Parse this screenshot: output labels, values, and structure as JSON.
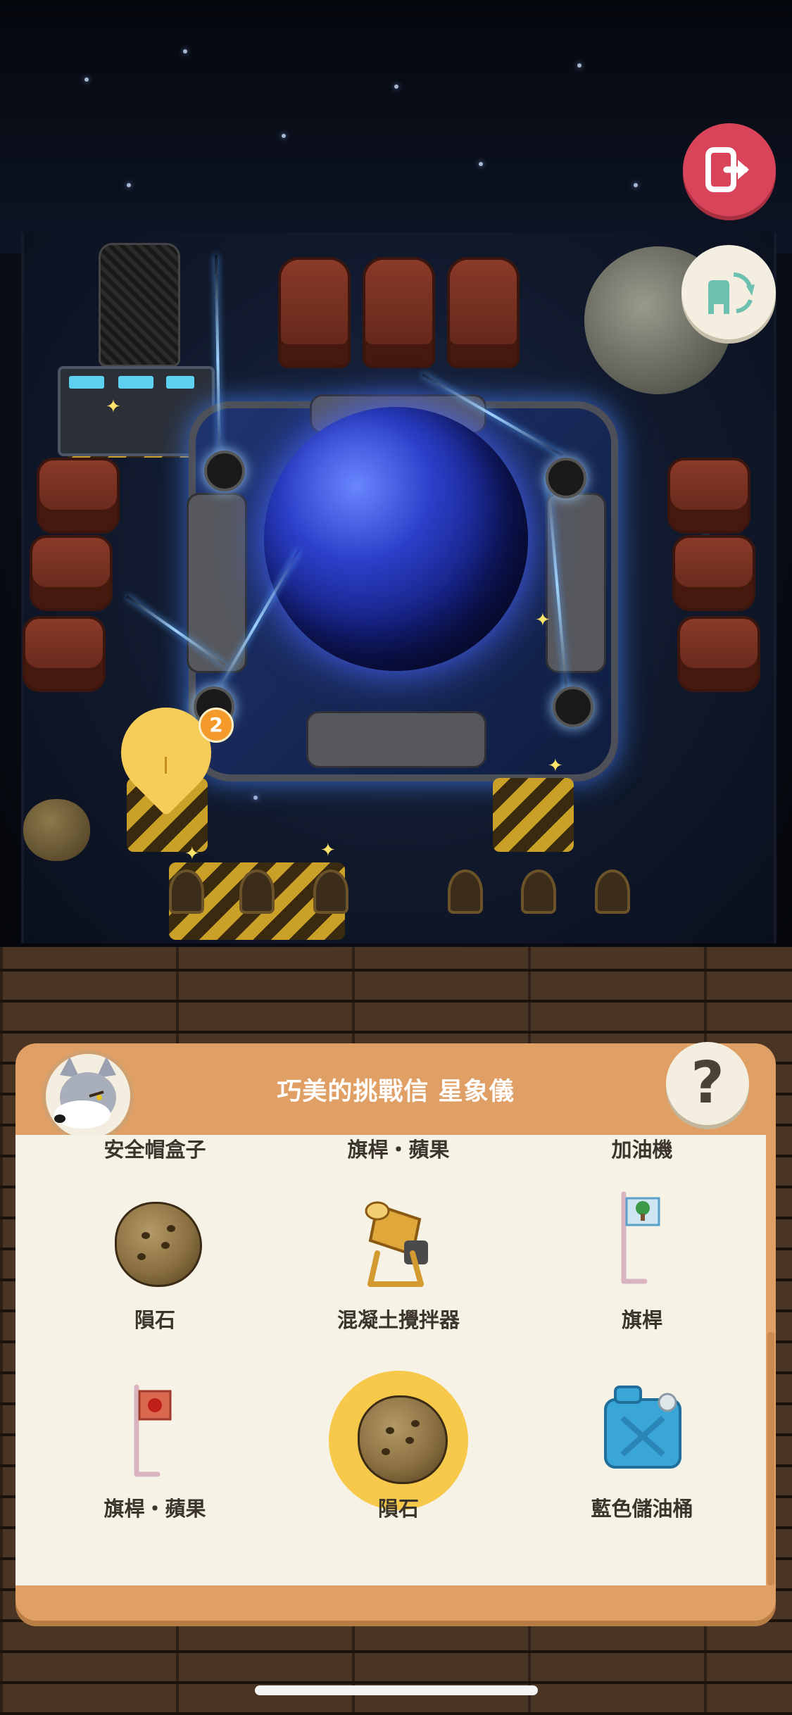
{
  "panel": {
    "title": "巧美的挑戰信 星象儀",
    "help_label": "?"
  },
  "notification": {
    "badge_count": "2"
  },
  "items": {
    "row0": [
      "安全帽盒子",
      "旗桿・蘋果",
      "加油機"
    ],
    "row1": [
      "隕石",
      "混凝土攪拌器",
      "旗桿"
    ],
    "row2": [
      "旗桿・蘋果",
      "隕石",
      "藍色儲油桶"
    ]
  },
  "selected_item": "隕石",
  "colors": {
    "panel_header": "#e0a065",
    "panel_body": "#f6f3e6",
    "exit_button": "#d9445a",
    "selection": "#f7c94a"
  },
  "icons": {
    "exit": "exit-door-icon",
    "rotate": "rotate-furniture-icon",
    "help": "question-icon"
  }
}
